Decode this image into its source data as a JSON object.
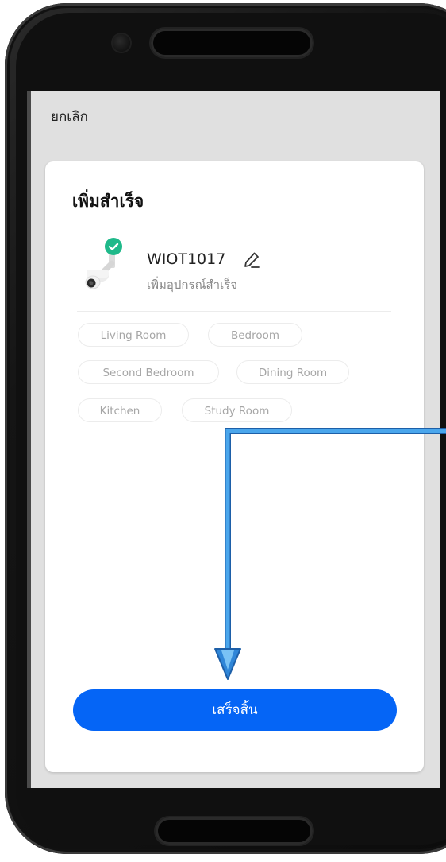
{
  "header": {
    "cancel_label": "ยกเลิก"
  },
  "card": {
    "title": "เพิ่มสำเร็จ",
    "device": {
      "name": "WIOT1017",
      "status": "เพิ่มอุปกรณ์สำเร็จ",
      "image_icon": "security-camera-icon",
      "badge_icon": "check-badge-icon",
      "edit_icon": "pencil-icon"
    },
    "rooms": [
      "Living Room",
      "Bedroom",
      "Second Bedroom",
      "Dining Room",
      "Kitchen",
      "Study Room"
    ],
    "done_label": "เสร็จสิ้น"
  },
  "colors": {
    "primary": "#0565f6",
    "check_badge": "#1fb98a",
    "arrow": "#3a97e8"
  }
}
